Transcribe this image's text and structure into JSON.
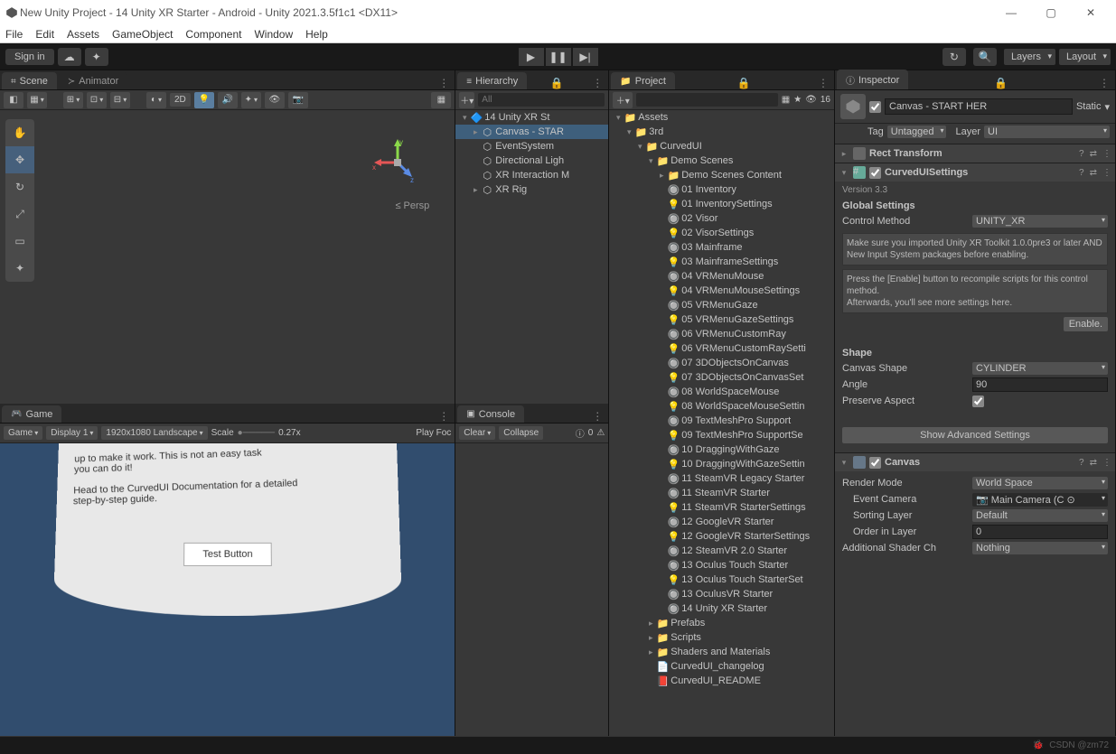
{
  "window": {
    "title": "New Unity Project - 14 Unity XR Starter - Android - Unity 2021.3.5f1c1 <DX11>"
  },
  "menu": [
    "File",
    "Edit",
    "Assets",
    "GameObject",
    "Component",
    "Window",
    "Help"
  ],
  "toptoolbar": {
    "signin": "Sign in",
    "layers": "Layers",
    "layout": "Layout"
  },
  "tabs": {
    "scene": "Scene",
    "animator": "Animator",
    "game": "Game",
    "hierarchy": "Hierarchy",
    "project": "Project",
    "console": "Console",
    "inspector": "Inspector"
  },
  "scene": {
    "mode2d": "2D",
    "persp": "≤ Persp",
    "axes": {
      "x": "x",
      "y": "y",
      "z": "z"
    }
  },
  "game_sub": {
    "target": "Game",
    "display": "Display 1",
    "resolution": "1920x1080 Landscape",
    "scale_label": "Scale",
    "scale_value": "0.27x",
    "playfoc": "Play Foc"
  },
  "game_panel": {
    "line1": "up to make it work. This is not an easy task",
    "line2": "you can do it!",
    "line3": "Head to the CurvedUI Documentation for a detailed",
    "line4": "step-by-step guide.",
    "button": "Test Button"
  },
  "hierarchy_sub": {
    "all": "All"
  },
  "hierarchy": [
    {
      "d": 0,
      "fold": "▾",
      "ico": "u",
      "t": "14 Unity XR St",
      "sel": false
    },
    {
      "d": 1,
      "fold": "▸",
      "ico": "c",
      "t": "Canvas - STAR",
      "sel": true
    },
    {
      "d": 1,
      "fold": "",
      "ico": "c",
      "t": "EventSystem",
      "sel": false
    },
    {
      "d": 1,
      "fold": "",
      "ico": "c",
      "t": "Directional Ligh",
      "sel": false
    },
    {
      "d": 1,
      "fold": "",
      "ico": "c",
      "t": "XR Interaction M",
      "sel": false
    },
    {
      "d": 1,
      "fold": "▸",
      "ico": "c",
      "t": "XR Rig",
      "sel": false
    }
  ],
  "project_sub": {
    "count": "16"
  },
  "project": [
    {
      "d": 0,
      "fold": "▾",
      "ico": "fo",
      "t": "Assets"
    },
    {
      "d": 1,
      "fold": "▾",
      "ico": "fo",
      "t": "3rd"
    },
    {
      "d": 2,
      "fold": "▾",
      "ico": "fo",
      "t": "CurvedUI"
    },
    {
      "d": 3,
      "fold": "▾",
      "ico": "fo",
      "t": "Demo Scenes"
    },
    {
      "d": 4,
      "fold": "▸",
      "ico": "fo",
      "t": "Demo Scenes Content"
    },
    {
      "d": 4,
      "fold": "",
      "ico": "sc",
      "t": "01 Inventory"
    },
    {
      "d": 4,
      "fold": "",
      "ico": "so",
      "t": "01 InventorySettings"
    },
    {
      "d": 4,
      "fold": "",
      "ico": "sc",
      "t": "02 Visor"
    },
    {
      "d": 4,
      "fold": "",
      "ico": "so",
      "t": "02 VisorSettings"
    },
    {
      "d": 4,
      "fold": "",
      "ico": "sc",
      "t": "03 Mainframe"
    },
    {
      "d": 4,
      "fold": "",
      "ico": "so",
      "t": "03 MainframeSettings"
    },
    {
      "d": 4,
      "fold": "",
      "ico": "sc",
      "t": "04 VRMenuMouse"
    },
    {
      "d": 4,
      "fold": "",
      "ico": "so",
      "t": "04 VRMenuMouseSettings"
    },
    {
      "d": 4,
      "fold": "",
      "ico": "sc",
      "t": "05 VRMenuGaze"
    },
    {
      "d": 4,
      "fold": "",
      "ico": "so",
      "t": "05 VRMenuGazeSettings"
    },
    {
      "d": 4,
      "fold": "",
      "ico": "sc",
      "t": "06 VRMenuCustomRay"
    },
    {
      "d": 4,
      "fold": "",
      "ico": "so",
      "t": "06 VRMenuCustomRaySetti"
    },
    {
      "d": 4,
      "fold": "",
      "ico": "sc",
      "t": "07 3DObjectsOnCanvas"
    },
    {
      "d": 4,
      "fold": "",
      "ico": "so",
      "t": "07 3DObjectsOnCanvasSet"
    },
    {
      "d": 4,
      "fold": "",
      "ico": "sc",
      "t": "08 WorldSpaceMouse"
    },
    {
      "d": 4,
      "fold": "",
      "ico": "so",
      "t": "08 WorldSpaceMouseSettin"
    },
    {
      "d": 4,
      "fold": "",
      "ico": "sc",
      "t": "09 TextMeshPro Support"
    },
    {
      "d": 4,
      "fold": "",
      "ico": "so",
      "t": "09 TextMeshPro SupportSe"
    },
    {
      "d": 4,
      "fold": "",
      "ico": "sc",
      "t": "10 DraggingWithGaze"
    },
    {
      "d": 4,
      "fold": "",
      "ico": "so",
      "t": "10 DraggingWithGazeSettin"
    },
    {
      "d": 4,
      "fold": "",
      "ico": "sc",
      "t": "11 SteamVR Legacy Starter"
    },
    {
      "d": 4,
      "fold": "",
      "ico": "sc",
      "t": "11 SteamVR Starter"
    },
    {
      "d": 4,
      "fold": "",
      "ico": "so",
      "t": "11 SteamVR StarterSettings"
    },
    {
      "d": 4,
      "fold": "",
      "ico": "sc",
      "t": "12 GoogleVR Starter"
    },
    {
      "d": 4,
      "fold": "",
      "ico": "so",
      "t": "12 GoogleVR StarterSettings"
    },
    {
      "d": 4,
      "fold": "",
      "ico": "sc",
      "t": "12 SteamVR 2.0 Starter"
    },
    {
      "d": 4,
      "fold": "",
      "ico": "sc",
      "t": "13 Oculus Touch Starter"
    },
    {
      "d": 4,
      "fold": "",
      "ico": "so",
      "t": "13 Oculus Touch StarterSet"
    },
    {
      "d": 4,
      "fold": "",
      "ico": "sc",
      "t": "13 OculusVR Starter"
    },
    {
      "d": 4,
      "fold": "",
      "ico": "sc",
      "t": "14 Unity XR Starter"
    },
    {
      "d": 3,
      "fold": "▸",
      "ico": "fo",
      "t": "Prefabs"
    },
    {
      "d": 3,
      "fold": "▸",
      "ico": "fo",
      "t": "Scripts"
    },
    {
      "d": 3,
      "fold": "▸",
      "ico": "fo",
      "t": "Shaders and Materials"
    },
    {
      "d": 3,
      "fold": "",
      "ico": "tx",
      "t": "CurvedUI_changelog"
    },
    {
      "d": 3,
      "fold": "",
      "ico": "pd",
      "t": "CurvedUI_README"
    }
  ],
  "console_sub": {
    "clear": "Clear",
    "collapse": "Collapse",
    "count": "0"
  },
  "inspector": {
    "name": "Canvas - START HER",
    "static": "Static",
    "tag_label": "Tag",
    "tag_value": "Untagged",
    "layer_label": "Layer",
    "layer_value": "UI",
    "rect_transform": "Rect Transform",
    "curvedui": {
      "title": "CurvedUISettings",
      "version": "Version 3.3",
      "global": "Global Settings",
      "control_method_label": "Control Method",
      "control_method_value": "UNITY_XR",
      "help1": "Make sure you imported Unity XR Toolkit 1.0.0pre3 or later AND New Input System packages before enabling.",
      "help2": "Press the [Enable] button to recompile scripts for this control method.\nAfterwards, you'll see more settings here.",
      "enable": "Enable.",
      "shape": "Shape",
      "canvas_shape_label": "Canvas Shape",
      "canvas_shape_value": "CYLINDER",
      "angle_label": "Angle",
      "angle_value": "90",
      "preserve_label": "Preserve Aspect",
      "advanced": "Show Advanced Settings"
    },
    "canvas": {
      "title": "Canvas",
      "render_mode_label": "Render Mode",
      "render_mode_value": "World Space",
      "event_camera_label": "Event Camera",
      "event_camera_value": "Main Camera (C",
      "sorting_layer_label": "Sorting Layer",
      "sorting_layer_value": "Default",
      "order_label": "Order in Layer",
      "order_value": "0",
      "shader_label": "Additional Shader Ch",
      "shader_value": "Nothing"
    }
  },
  "footer": {
    "watermark": "CSDN @zm72"
  }
}
